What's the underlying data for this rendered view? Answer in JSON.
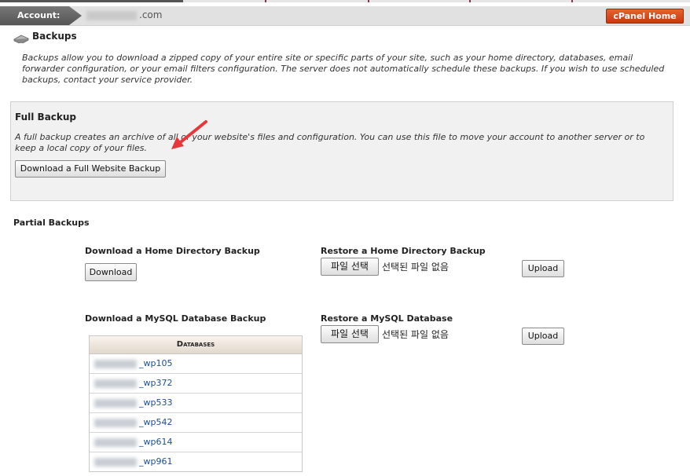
{
  "header": {
    "account_label": "Account:",
    "domain_suffix": ".com",
    "cpanel_home": "cPanel Home"
  },
  "page": {
    "title": "Backups",
    "intro": "Backups allow you to download a zipped copy of your entire site or specific parts of your site, such as your home directory, databases, email forwarder configuration, or your email filters configuration. The server does not automatically schedule these backups. If you wish to use scheduled backups, contact your service provider."
  },
  "full_backup": {
    "title": "Full Backup",
    "description": "A full backup creates an archive of all of your website's files and configuration. You can use this file to move your account to another server or to keep a local copy of your files.",
    "button": "Download a Full Website Backup"
  },
  "partial": {
    "title": "Partial Backups",
    "home_download": {
      "heading": "Download a Home Directory Backup",
      "button": "Download"
    },
    "home_restore": {
      "heading": "Restore a Home Directory Backup",
      "choose_file": "파일 선택",
      "no_file": "선택된 파일 없음",
      "upload": "Upload"
    },
    "mysql_download": {
      "heading": "Download a MySQL Database Backup",
      "table_header": "Databases",
      "databases": [
        "_wp105",
        "_wp372",
        "_wp533",
        "_wp542",
        "_wp614",
        "_wp961"
      ]
    },
    "mysql_restore": {
      "heading": "Restore a MySQL Database",
      "choose_file": "파일 선택",
      "no_file": "선택된 파일 없음",
      "upload": "Upload"
    }
  },
  "colors": {
    "cpanel_button": "#d9491a",
    "arrow": "#e8373a",
    "link": "#1b4f92"
  },
  "icons": {
    "title_icon": "backup-disk-icon",
    "annotation": "red-arrow-icon"
  }
}
